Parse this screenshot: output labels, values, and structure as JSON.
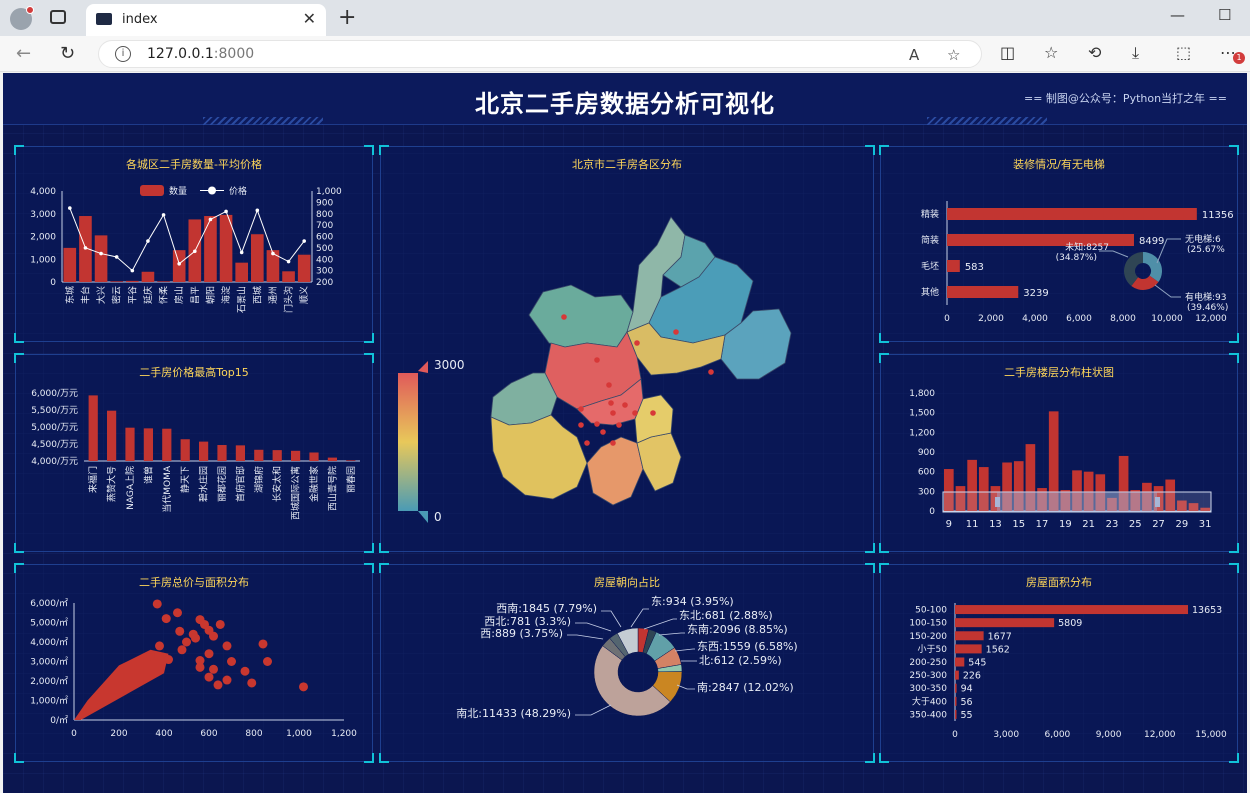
{
  "browser": {
    "tab_title": "index",
    "url_host": "127.0.0.1",
    "url_port": ":8000",
    "badge": "1"
  },
  "dashboard": {
    "title": "北京二手房数据分析可视化",
    "credit": "== 制图@公众号：Python当打之年 =="
  },
  "panels": {
    "district": "各城区二手房数量-平均价格",
    "map": "北京市二手房各区分布",
    "decoration": "装修情况/有无电梯",
    "top15": "二手房价格最高Top15",
    "floor": "二手房楼层分布柱状图",
    "scatter": "二手房总价与面积分布",
    "orientation": "房屋朝向占比",
    "area": "房屋面积分布"
  },
  "chart_data": [
    {
      "id": "district",
      "type": "bar",
      "categories": [
        "东城",
        "丰台",
        "大兴",
        "密云",
        "平谷",
        "延庆",
        "怀柔",
        "房山",
        "昌平",
        "朝阳",
        "海淀",
        "石景山",
        "西城",
        "通州",
        "门头沟",
        "顺义"
      ],
      "series": [
        {
          "name": "数量",
          "type": "bar",
          "axis": "left",
          "values": [
            1500,
            2900,
            2050,
            30,
            50,
            450,
            30,
            1400,
            2750,
            2900,
            2950,
            850,
            2100,
            1400,
            470,
            1200
          ]
        },
        {
          "name": "价格",
          "type": "line",
          "axis": "right",
          "values": [
            850,
            500,
            450,
            420,
            300,
            560,
            790,
            360,
            470,
            750,
            820,
            460,
            830,
            450,
            380,
            560
          ]
        }
      ],
      "yleft": {
        "ticks": [
          "0",
          "1,000",
          "2,000",
          "3,000",
          "4,000"
        ],
        "ylim": [
          0,
          4000
        ]
      },
      "yright": {
        "ticks": [
          "200",
          "300",
          "400",
          "500",
          "600",
          "700",
          "800",
          "900",
          "1,000"
        ],
        "ylim": [
          200,
          1000
        ]
      },
      "legend": "top-center"
    },
    {
      "id": "map",
      "type": "heatmap",
      "visual_map": {
        "max": "3000",
        "min": "0",
        "colors": [
          "#4a9bb5",
          "#e8c85a",
          "#e05a5a"
        ]
      }
    },
    {
      "id": "decoration",
      "type": "bar",
      "orientation": "horizontal",
      "categories": [
        "精装",
        "简装",
        "毛坯",
        "其他"
      ],
      "values": [
        11356,
        8499,
        583,
        3239
      ],
      "value_labels": [
        "11356",
        "8499",
        "583",
        "3239"
      ],
      "xticks": [
        "0",
        "2,000",
        "4,000",
        "6,000",
        "8,000",
        "10,000",
        "12,000"
      ],
      "xlim": [
        0,
        12000
      ],
      "pie": {
        "labels": [
          "未知:8257",
          "(34.87%)",
          "无电梯:6",
          "(25.67%",
          "有电梯:93",
          "(39.46%)"
        ],
        "slices": [
          {
            "name": "未知",
            "value": 34.87,
            "color": "#4f8fa8"
          },
          {
            "name": "无电梯",
            "value": 25.67,
            "color": "#c23531"
          },
          {
            "name": "有电梯",
            "value": 39.46,
            "color": "#2f4554"
          }
        ]
      }
    },
    {
      "id": "top15",
      "type": "bar",
      "categories": [
        "来福门",
        "燕赞大号",
        "NAGA上院",
        "谁曾",
        "当代MOMA",
        "静天下",
        "碧水庄园",
        "丽都花园",
        "首府官邸",
        "湖锦府",
        "长安太和",
        "西城国际公寓",
        "金融世家",
        "西山壹号院",
        "丽春园"
      ],
      "values": [
        5930,
        5480,
        4980,
        4960,
        4950,
        4640,
        4570,
        4470,
        4460,
        4330,
        4320,
        4300,
        4250,
        4100,
        4020
      ],
      "yticks": [
        "4,000/万元",
        "4,500/万元",
        "5,000/万元",
        "5,500/万元",
        "6,000/万元"
      ],
      "ylim": [
        4000,
        6000
      ]
    },
    {
      "id": "floor",
      "type": "bar",
      "categories": [
        "9",
        "10",
        "11",
        "12",
        "13",
        "14",
        "15",
        "16",
        "17",
        "18",
        "19",
        "20",
        "21",
        "22",
        "23",
        "24",
        "25",
        "26",
        "27",
        "28",
        "29",
        "30",
        "31"
      ],
      "x_ticks": [
        "9",
        "11",
        "13",
        "15",
        "17",
        "19",
        "21",
        "23",
        "25",
        "27",
        "29",
        "31"
      ],
      "values": [
        640,
        380,
        780,
        670,
        380,
        740,
        760,
        1020,
        350,
        1520,
        320,
        620,
        600,
        560,
        200,
        840,
        320,
        430,
        380,
        480,
        160,
        120,
        50
      ],
      "yticks": [
        "0",
        "300",
        "600",
        "900",
        "1,200",
        "1,500",
        "1,800"
      ],
      "ylim": [
        0,
        1800
      ]
    },
    {
      "id": "scatter",
      "type": "scatter",
      "xticks": [
        "0",
        "200",
        "400",
        "600",
        "800",
        "1,000",
        "1,200"
      ],
      "yticks": [
        "0/㎡",
        "1,000/㎡",
        "2,000/㎡",
        "3,000/㎡",
        "4,000/㎡",
        "5,000/㎡",
        "6,000/㎡"
      ],
      "xlim": [
        0,
        1200
      ],
      "ylim": [
        0,
        6000
      ],
      "points": [
        [
          370,
          5950
        ],
        [
          460,
          5500
        ],
        [
          410,
          5200
        ],
        [
          560,
          5150
        ],
        [
          580,
          4900
        ],
        [
          650,
          4900
        ],
        [
          470,
          4550
        ],
        [
          530,
          4400
        ],
        [
          600,
          4600
        ],
        [
          540,
          4200
        ],
        [
          620,
          4300
        ],
        [
          500,
          4000
        ],
        [
          680,
          3800
        ],
        [
          840,
          3900
        ],
        [
          860,
          3000
        ],
        [
          600,
          3400
        ],
        [
          560,
          3050
        ],
        [
          700,
          3000
        ],
        [
          620,
          2600
        ],
        [
          760,
          2500
        ],
        [
          600,
          2200
        ],
        [
          680,
          2050
        ],
        [
          790,
          1900
        ],
        [
          1020,
          1700
        ],
        [
          640,
          1800
        ],
        [
          560,
          2700
        ],
        [
          480,
          3600
        ],
        [
          420,
          3100
        ],
        [
          380,
          3800
        ],
        [
          340,
          3300
        ]
      ]
    },
    {
      "id": "orientation",
      "type": "pie",
      "labels": [
        "东:934 (3.95%)",
        "东北:681 (2.88%)",
        "东南:2096 (8.85%)",
        "东西:1559 (6.58%)",
        "北:612 (2.59%)",
        "南:2847 (12.02%)",
        "南北:11433 (48.29%)",
        "西:889 (3.75%)",
        "西北:781 (3.3%)",
        "西南:1845 (7.79%)"
      ],
      "values": [
        3.95,
        2.88,
        8.85,
        6.58,
        2.59,
        12.02,
        48.29,
        3.75,
        3.3,
        7.79
      ],
      "colors": [
        "#c23531",
        "#2f4554",
        "#61a0a8",
        "#d48265",
        "#91c7ae",
        "#ca8622",
        "#bda29a",
        "#6e7074",
        "#546570",
        "#c4ccd3"
      ]
    },
    {
      "id": "area",
      "type": "bar",
      "orientation": "horizontal",
      "categories": [
        "50-100",
        "100-150",
        "150-200",
        "小于50",
        "200-250",
        "250-300",
        "300-350",
        "大于400",
        "350-400"
      ],
      "values": [
        13653,
        5809,
        1677,
        1562,
        545,
        226,
        94,
        56,
        55
      ],
      "value_labels": [
        "13653",
        "5809",
        "1677",
        "1562",
        "545",
        "226",
        "94",
        "56",
        "55"
      ],
      "xticks": [
        "0",
        "3,000",
        "6,000",
        "9,000",
        "12,000",
        "15,000"
      ],
      "xlim": [
        0,
        15000
      ]
    }
  ]
}
